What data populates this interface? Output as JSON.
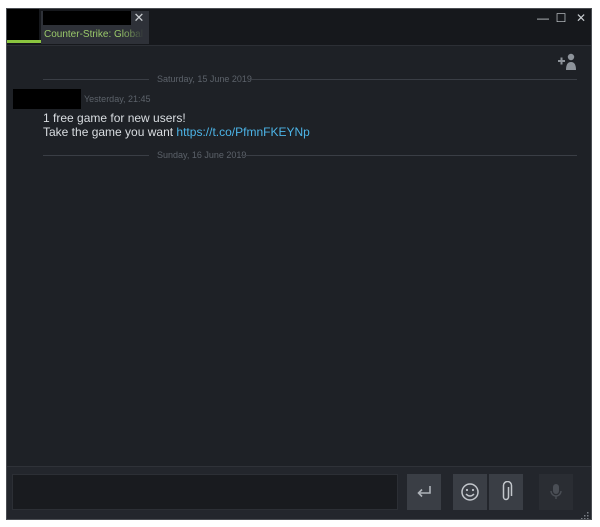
{
  "window": {
    "tab": {
      "game_name": "Counter-Strike: Global Offensive",
      "close_glyph": "✕"
    },
    "controls": {
      "minimize": "—",
      "maximize": "☐",
      "close": "✕"
    }
  },
  "chat": {
    "dividers": [
      {
        "label": "Saturday, 15 June 2019"
      },
      {
        "label": "Sunday, 16 June 2019"
      }
    ],
    "message": {
      "timestamp": "Yesterday, 21:45",
      "line1": "1 free game for new users!",
      "line2_prefix": "Take the game you want ",
      "link": "https://t.co/PfmnFKEYNp"
    }
  },
  "input": {
    "placeholder": "",
    "value": ""
  },
  "icons": {
    "add_friend": "add-friend-icon",
    "send": "enter-arrow-icon",
    "emoji": "smiley-icon",
    "attach": "paperclip-icon",
    "voice": "microphone-icon",
    "resize": "resize-grip-icon"
  },
  "colors": {
    "background": "#1e2126",
    "accent_green": "#8bc53f",
    "link_blue": "#4cb4e7",
    "text": "#d9dde1",
    "muted": "#5c626a"
  }
}
